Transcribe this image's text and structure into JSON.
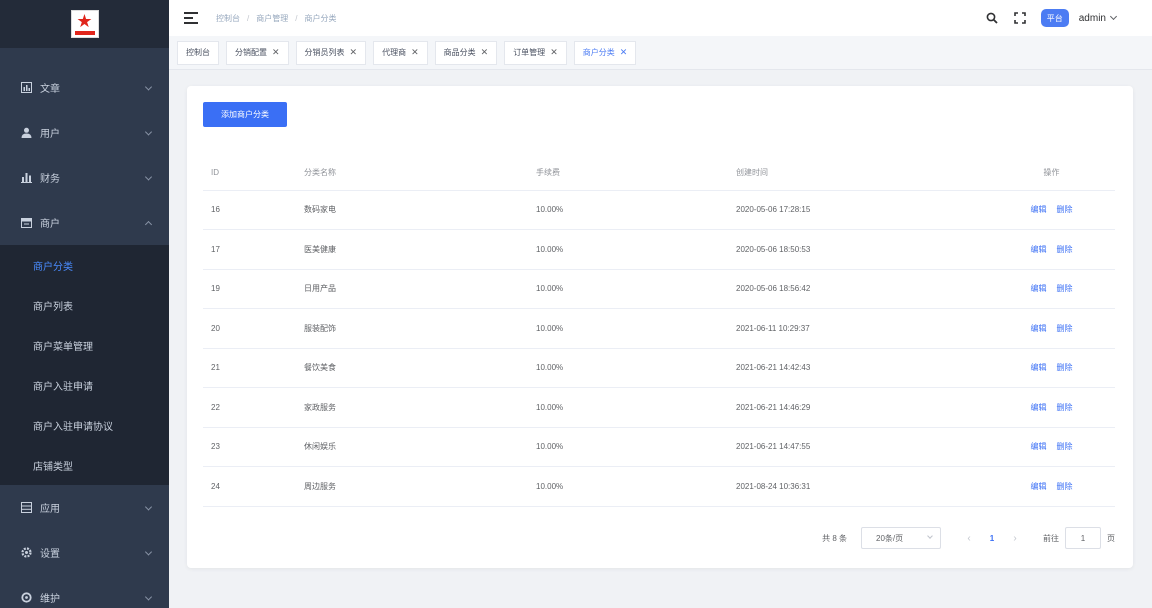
{
  "sidebar": {
    "items": [
      {
        "label": "文章",
        "icon": "chart-icon"
      },
      {
        "label": "用户",
        "icon": "user-icon"
      },
      {
        "label": "财务",
        "icon": "bar-chart-icon"
      },
      {
        "label": "商户",
        "icon": "store-icon",
        "expanded": true
      }
    ],
    "sub_items": [
      {
        "label": "商户分类",
        "active": true
      },
      {
        "label": "商户列表"
      },
      {
        "label": "商户菜单管理"
      },
      {
        "label": "商户入驻申请"
      },
      {
        "label": "商户入驻申请协议"
      },
      {
        "label": "店铺类型"
      }
    ],
    "bottom_items": [
      {
        "label": "应用",
        "icon": "grid-icon"
      },
      {
        "label": "设置",
        "icon": "gear-icon"
      },
      {
        "label": "维护",
        "icon": "wrench-icon"
      }
    ]
  },
  "header": {
    "breadcrumb": [
      "控制台",
      "商户管理",
      "商户分类"
    ],
    "badge": "平台",
    "user": "admin"
  },
  "tags": [
    {
      "label": "控制台",
      "closable": false
    },
    {
      "label": "分销配置",
      "closable": true
    },
    {
      "label": "分销员列表",
      "closable": true
    },
    {
      "label": "代理商",
      "closable": true
    },
    {
      "label": "商品分类",
      "closable": true
    },
    {
      "label": "订单管理",
      "closable": true
    },
    {
      "label": "商户分类",
      "closable": true,
      "active": true
    }
  ],
  "main": {
    "add_button": "添加商户分类",
    "table": {
      "headers": [
        "ID",
        "分类名称",
        "手续费",
        "创建时间",
        "操作"
      ],
      "rows": [
        {
          "id": "16",
          "name": "数码家电",
          "fee": "10.00%",
          "time": "2020-05-06 17:28:15"
        },
        {
          "id": "17",
          "name": "医美健康",
          "fee": "10.00%",
          "time": "2020-05-06 18:50:53"
        },
        {
          "id": "19",
          "name": "日用产品",
          "fee": "10.00%",
          "time": "2020-05-06 18:56:42"
        },
        {
          "id": "20",
          "name": "服装配饰",
          "fee": "10.00%",
          "time": "2021-06-11 10:29:37"
        },
        {
          "id": "21",
          "name": "餐饮美食",
          "fee": "10.00%",
          "time": "2021-06-21 14:42:43"
        },
        {
          "id": "22",
          "name": "家政服务",
          "fee": "10.00%",
          "time": "2021-06-21 14:46:29"
        },
        {
          "id": "23",
          "name": "休闲娱乐",
          "fee": "10.00%",
          "time": "2021-06-21 14:47:55"
        },
        {
          "id": "24",
          "name": "周边服务",
          "fee": "10.00%",
          "time": "2021-08-24 10:36:31"
        }
      ],
      "edit_label": "编辑",
      "delete_label": "删除"
    },
    "pagination": {
      "total": "共 8 条",
      "page_size": "20条/页",
      "current": "1",
      "goto_label": "前往",
      "goto_value": "1",
      "page_suffix": "页"
    }
  },
  "colors": {
    "primary": "#3a6ff5",
    "sidebar": "#2f3a4d",
    "submenu": "#1f2633"
  }
}
